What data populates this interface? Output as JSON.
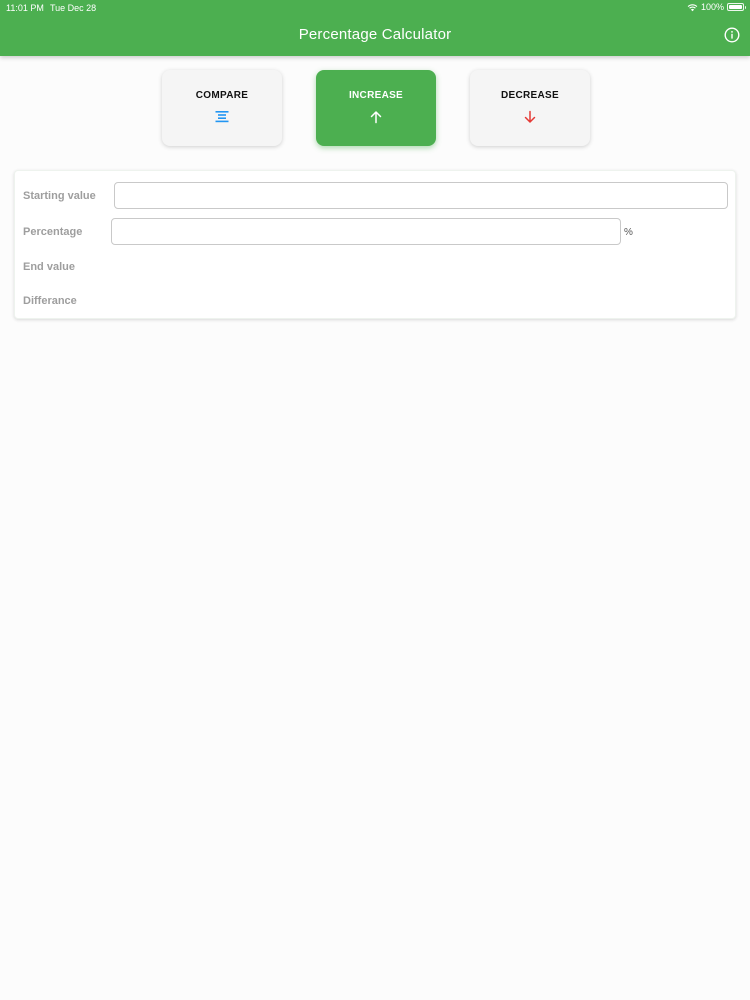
{
  "status_bar": {
    "time": "11:01 PM",
    "date": "Tue Dec 28",
    "battery": "100%",
    "battery_level": 1.0
  },
  "app_bar": {
    "title": "Percentage Calculator",
    "info_icon": "info-circle-icon",
    "background_color": "#4caf50"
  },
  "modes": [
    {
      "label": "COMPARE",
      "icon": "align-center-icon",
      "icon_color": "#2196f3",
      "selected": false
    },
    {
      "label": "INCREASE",
      "icon": "arrow-up-icon",
      "icon_color": "#ffffff",
      "selected": true
    },
    {
      "label": "DECREASE",
      "icon": "arrow-down-icon",
      "icon_color": "#e53935",
      "selected": false
    }
  ],
  "form": {
    "starting_value": {
      "label": "Starting value",
      "value": "",
      "placeholder": ""
    },
    "percentage": {
      "label": "Percentage",
      "value": "",
      "placeholder": "",
      "suffix": "%"
    },
    "end_value": {
      "label": "End value",
      "value": ""
    },
    "difference": {
      "label": "Differance",
      "value": ""
    }
  }
}
